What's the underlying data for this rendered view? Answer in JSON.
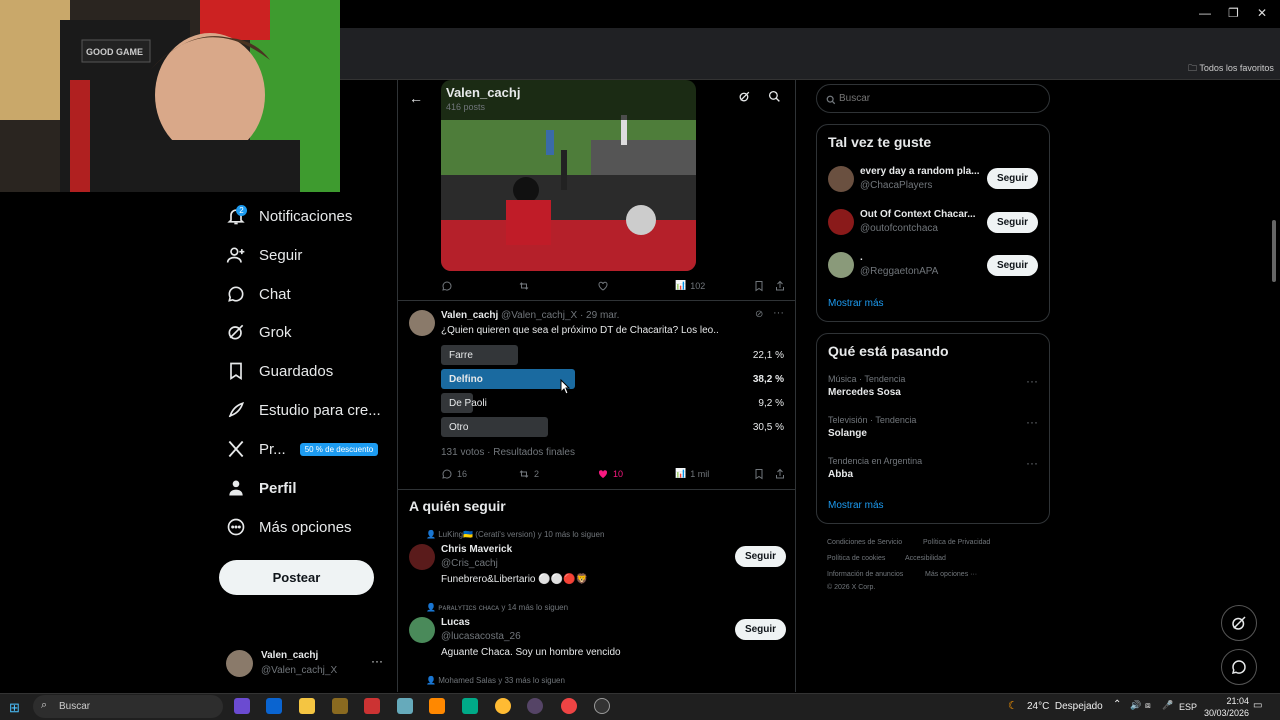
{
  "browser": {
    "bookmarks_folder": "Todos los favoritos",
    "window_controls": [
      "minimize",
      "restore",
      "close"
    ]
  },
  "webcam": {
    "chair_label": "GOOD GAME"
  },
  "header": {
    "name": "Valen_cachj",
    "posts": "416 posts"
  },
  "first_post": {
    "views": "102"
  },
  "poll_post": {
    "author": "Valen_cachj",
    "handle": "@Valen_cachj_X",
    "date": "· 29 mar.",
    "text": "¿Quien quieren que sea el próximo DT de Chacarita? Los leo..",
    "options": [
      {
        "label": "Farre",
        "pct": "22,1 %",
        "fraction": 0.221
      },
      {
        "label": "Delfino",
        "pct": "38,2 %",
        "fraction": 0.382
      },
      {
        "label": "De Paoli",
        "pct": "9,2 %",
        "fraction": 0.092
      },
      {
        "label": "Otro",
        "pct": "30,5 %",
        "fraction": 0.305
      }
    ],
    "summary": "131 votos · Resultados finales",
    "replies": "16",
    "reposts": "2",
    "likes": "10",
    "views": "1 mil"
  },
  "who_to_follow": {
    "title": "A quién seguir",
    "users": [
      {
        "context": "LuKing🇺🇦 (Cerati's version) y 10 más lo siguen",
        "name": "Chris Maverick",
        "handle": "@Cris_cachj",
        "bio": "Funebrero&Libertario ⚪⚪🔴🦁",
        "button": "Seguir"
      },
      {
        "context": "ᴘᴀʀᴀʟʏᴛɪᴄs ᴄʜᴀᴄᴀ y 14 más lo siguen",
        "name": "Lucas",
        "handle": "@lucasacosta_26",
        "bio": "Aguante Chaca. Soy un hombre vencido",
        "button": "Seguir"
      },
      {
        "context": "Mohamed Salas y 33 más lo siguen"
      }
    ]
  },
  "left_nav": {
    "items": [
      {
        "label": "Notificaciones",
        "icon": "bell-icon",
        "badge": "2"
      },
      {
        "label": "Seguir",
        "icon": "person-plus-icon"
      },
      {
        "label": "Chat",
        "icon": "chat-bubble-icon"
      },
      {
        "label": "Grok",
        "icon": "grok-icon"
      },
      {
        "label": "Guardados",
        "icon": "bookmark-icon"
      },
      {
        "label": "Estudio para cre...",
        "icon": "rocket-icon"
      },
      {
        "label": "Pr...",
        "icon": "x-logo-icon",
        "badge": "50 % de descuento"
      },
      {
        "label": "Perfil",
        "icon": "person-icon"
      },
      {
        "label": "Más opciones",
        "icon": "more-circle-icon"
      }
    ],
    "post_button": "Postear",
    "account": {
      "name": "Valen_cachj",
      "handle": "@Valen_cachj_X"
    }
  },
  "search": {
    "placeholder": "Buscar"
  },
  "suggestions": {
    "title": "Tal vez te guste",
    "users": [
      {
        "name": "every day a random pla...",
        "handle": "@ChacaPlayers",
        "button": "Seguir"
      },
      {
        "name": "Out Of Context Chacar...",
        "handle": "@outofcontchaca",
        "button": "Seguir"
      },
      {
        "name": ".",
        "handle": "@ReggaetonAPA",
        "button": "Seguir"
      }
    ],
    "show_more": "Mostrar más"
  },
  "trends": {
    "title": "Qué está pasando",
    "items": [
      {
        "kicker": "Música · Tendencia",
        "name": "Mercedes Sosa"
      },
      {
        "kicker": "Televisión · Tendencia",
        "name": "Solange"
      },
      {
        "kicker": "Tendencia en Argentina",
        "name": "Abba"
      }
    ],
    "show_more": "Mostrar más"
  },
  "footer": {
    "links": [
      "Condiciones de Servicio",
      "Política de Privacidad",
      "Política de cookies",
      "Accesibilidad",
      "Información de anuncios",
      "Más opciones ···"
    ],
    "copyright": "© 2026 X Corp."
  },
  "taskbar": {
    "search": "Buscar",
    "weather": "24°C  Despejado",
    "lang": "ESP",
    "time": "21:04",
    "date": "30/03/2026"
  },
  "colors": {
    "accent": "#1d9bf0",
    "winner_bar": "#1a6aa0",
    "like": "#f91880"
  }
}
